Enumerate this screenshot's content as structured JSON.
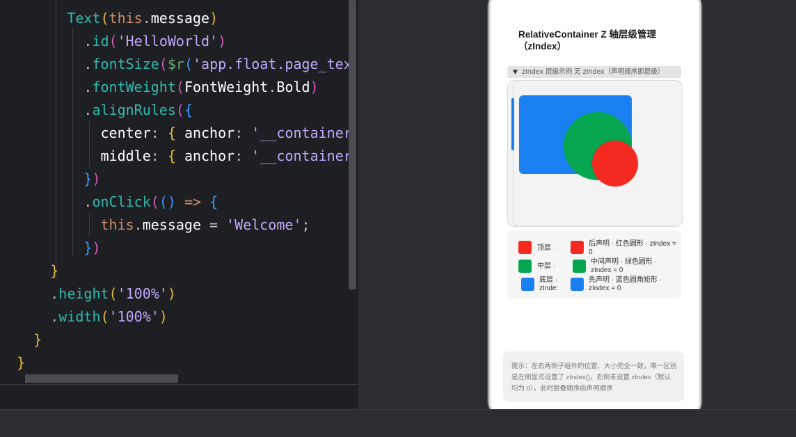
{
  "editor": {
    "lines": [
      {
        "indent": "        ",
        "tokens": [
          [
            "t-teal",
            "Text"
          ],
          [
            "t-yellow",
            "("
          ],
          [
            "t-kw",
            "this"
          ],
          [
            "t-punc",
            "."
          ],
          [
            "t-white",
            "message"
          ],
          [
            "t-yellow",
            ")"
          ]
        ]
      },
      {
        "indent": "          ",
        "tokens": [
          [
            "t-punc",
            "."
          ],
          [
            "t-teal",
            "id"
          ],
          [
            "t-pink",
            "("
          ],
          [
            "t-str2",
            "'HelloWorld'"
          ],
          [
            "t-pink",
            ")"
          ]
        ]
      },
      {
        "indent": "          ",
        "tokens": [
          [
            "t-punc",
            "."
          ],
          [
            "t-teal",
            "fontSize"
          ],
          [
            "t-pink",
            "("
          ],
          [
            "t-str",
            "$r"
          ],
          [
            "t-blue2",
            "("
          ],
          [
            "t-str2",
            "'app.float.page_tex"
          ]
        ]
      },
      {
        "indent": "          ",
        "tokens": [
          [
            "t-punc",
            "."
          ],
          [
            "t-teal",
            "fontWeight"
          ],
          [
            "t-pink",
            "("
          ],
          [
            "t-white",
            "FontWeight"
          ],
          [
            "t-punc",
            "."
          ],
          [
            "t-white",
            "Bold"
          ],
          [
            "t-pink",
            ")"
          ]
        ]
      },
      {
        "indent": "          ",
        "tokens": [
          [
            "t-punc",
            "."
          ],
          [
            "t-teal",
            "alignRules"
          ],
          [
            "t-pink",
            "("
          ],
          [
            "t-blue2",
            "{"
          ]
        ]
      },
      {
        "indent": "            ",
        "tokens": [
          [
            "t-white",
            "center"
          ],
          [
            "t-punc",
            ": "
          ],
          [
            "t-yellow",
            "{ "
          ],
          [
            "t-white",
            "anchor"
          ],
          [
            "t-punc",
            ": "
          ],
          [
            "t-str2",
            "'__container"
          ]
        ]
      },
      {
        "indent": "            ",
        "tokens": [
          [
            "t-white",
            "middle"
          ],
          [
            "t-punc",
            ": "
          ],
          [
            "t-yellow",
            "{ "
          ],
          [
            "t-white",
            "anchor"
          ],
          [
            "t-punc",
            ": "
          ],
          [
            "t-str2",
            "'__container"
          ]
        ]
      },
      {
        "indent": "          ",
        "tokens": [
          [
            "t-blue2",
            "}"
          ],
          [
            "t-pink",
            ")"
          ]
        ]
      },
      {
        "indent": "          ",
        "tokens": [
          [
            "t-punc",
            "."
          ],
          [
            "t-teal",
            "onClick"
          ],
          [
            "t-pink",
            "("
          ],
          [
            "t-blue2",
            "()"
          ],
          [
            "t-kw",
            " => "
          ],
          [
            "t-blue2",
            "{"
          ]
        ]
      },
      {
        "indent": "            ",
        "tokens": [
          [
            "t-kw",
            "this"
          ],
          [
            "t-punc",
            "."
          ],
          [
            "t-white",
            "message"
          ],
          [
            "t-punc",
            " = "
          ],
          [
            "t-str2",
            "'Welcome'"
          ],
          [
            "t-punc",
            ";"
          ]
        ]
      },
      {
        "indent": "          ",
        "tokens": [
          [
            "t-blue2",
            "}"
          ],
          [
            "t-pink",
            ")"
          ]
        ]
      },
      {
        "indent": "      ",
        "tokens": [
          [
            "t-yellow",
            "}"
          ]
        ]
      },
      {
        "indent": "      ",
        "tokens": [
          [
            "t-punc",
            "."
          ],
          [
            "t-teal",
            "height"
          ],
          [
            "t-yellow",
            "("
          ],
          [
            "t-str2",
            "'100%'"
          ],
          [
            "t-yellow",
            ")"
          ]
        ]
      },
      {
        "indent": "      ",
        "tokens": [
          [
            "t-punc",
            "."
          ],
          [
            "t-teal",
            "width"
          ],
          [
            "t-yellow",
            "("
          ],
          [
            "t-str2",
            "'100%'"
          ],
          [
            "t-yellow",
            ")"
          ]
        ]
      },
      {
        "indent": "    ",
        "tokens": [
          [
            "t-yellow",
            "}"
          ]
        ]
      },
      {
        "indent": "  ",
        "tokens": [
          [
            "t-yellow",
            "}"
          ]
        ]
      }
    ]
  },
  "preview": {
    "title": "RelativeContainer  Z 轴层级管理（zIndex）",
    "collapse_label": "zIndex 层级示例 无 zIndex（声明顺序即层级）",
    "legend": {
      "rows": [
        {
          "color": "#f42a20",
          "left_label": "顶层 ·",
          "right_label_1": "后声明 · 红色圆形   ·  zIndex =",
          "right_label_2": "0"
        },
        {
          "color": "#06a54f",
          "left_label": "中层 ·",
          "right_label_1": "中间声明 · 绿色圆形  ·",
          "right_label_2": "zIndex = 0"
        },
        {
          "color": "#1a7ff0",
          "left_label": "底层 ·",
          "left_label_2": "zInde:",
          "right_label_1": "先声明 · 蓝色圆角矩形  ·",
          "right_label_2": "zIndex = 0"
        }
      ]
    },
    "hint": "提示：左右两侧子组件的位置、大小完全一致，唯一区别是左侧显式设置了 zIndex()，右侧未设置 zIndex（默认均为 0），此时层叠顺序由声明顺序"
  },
  "colors": {
    "editor_bg": "#1e1f22",
    "ide_bg": "#2b2d30",
    "red": "#f42a20",
    "green": "#06a54f",
    "blue": "#1a7ff0"
  }
}
